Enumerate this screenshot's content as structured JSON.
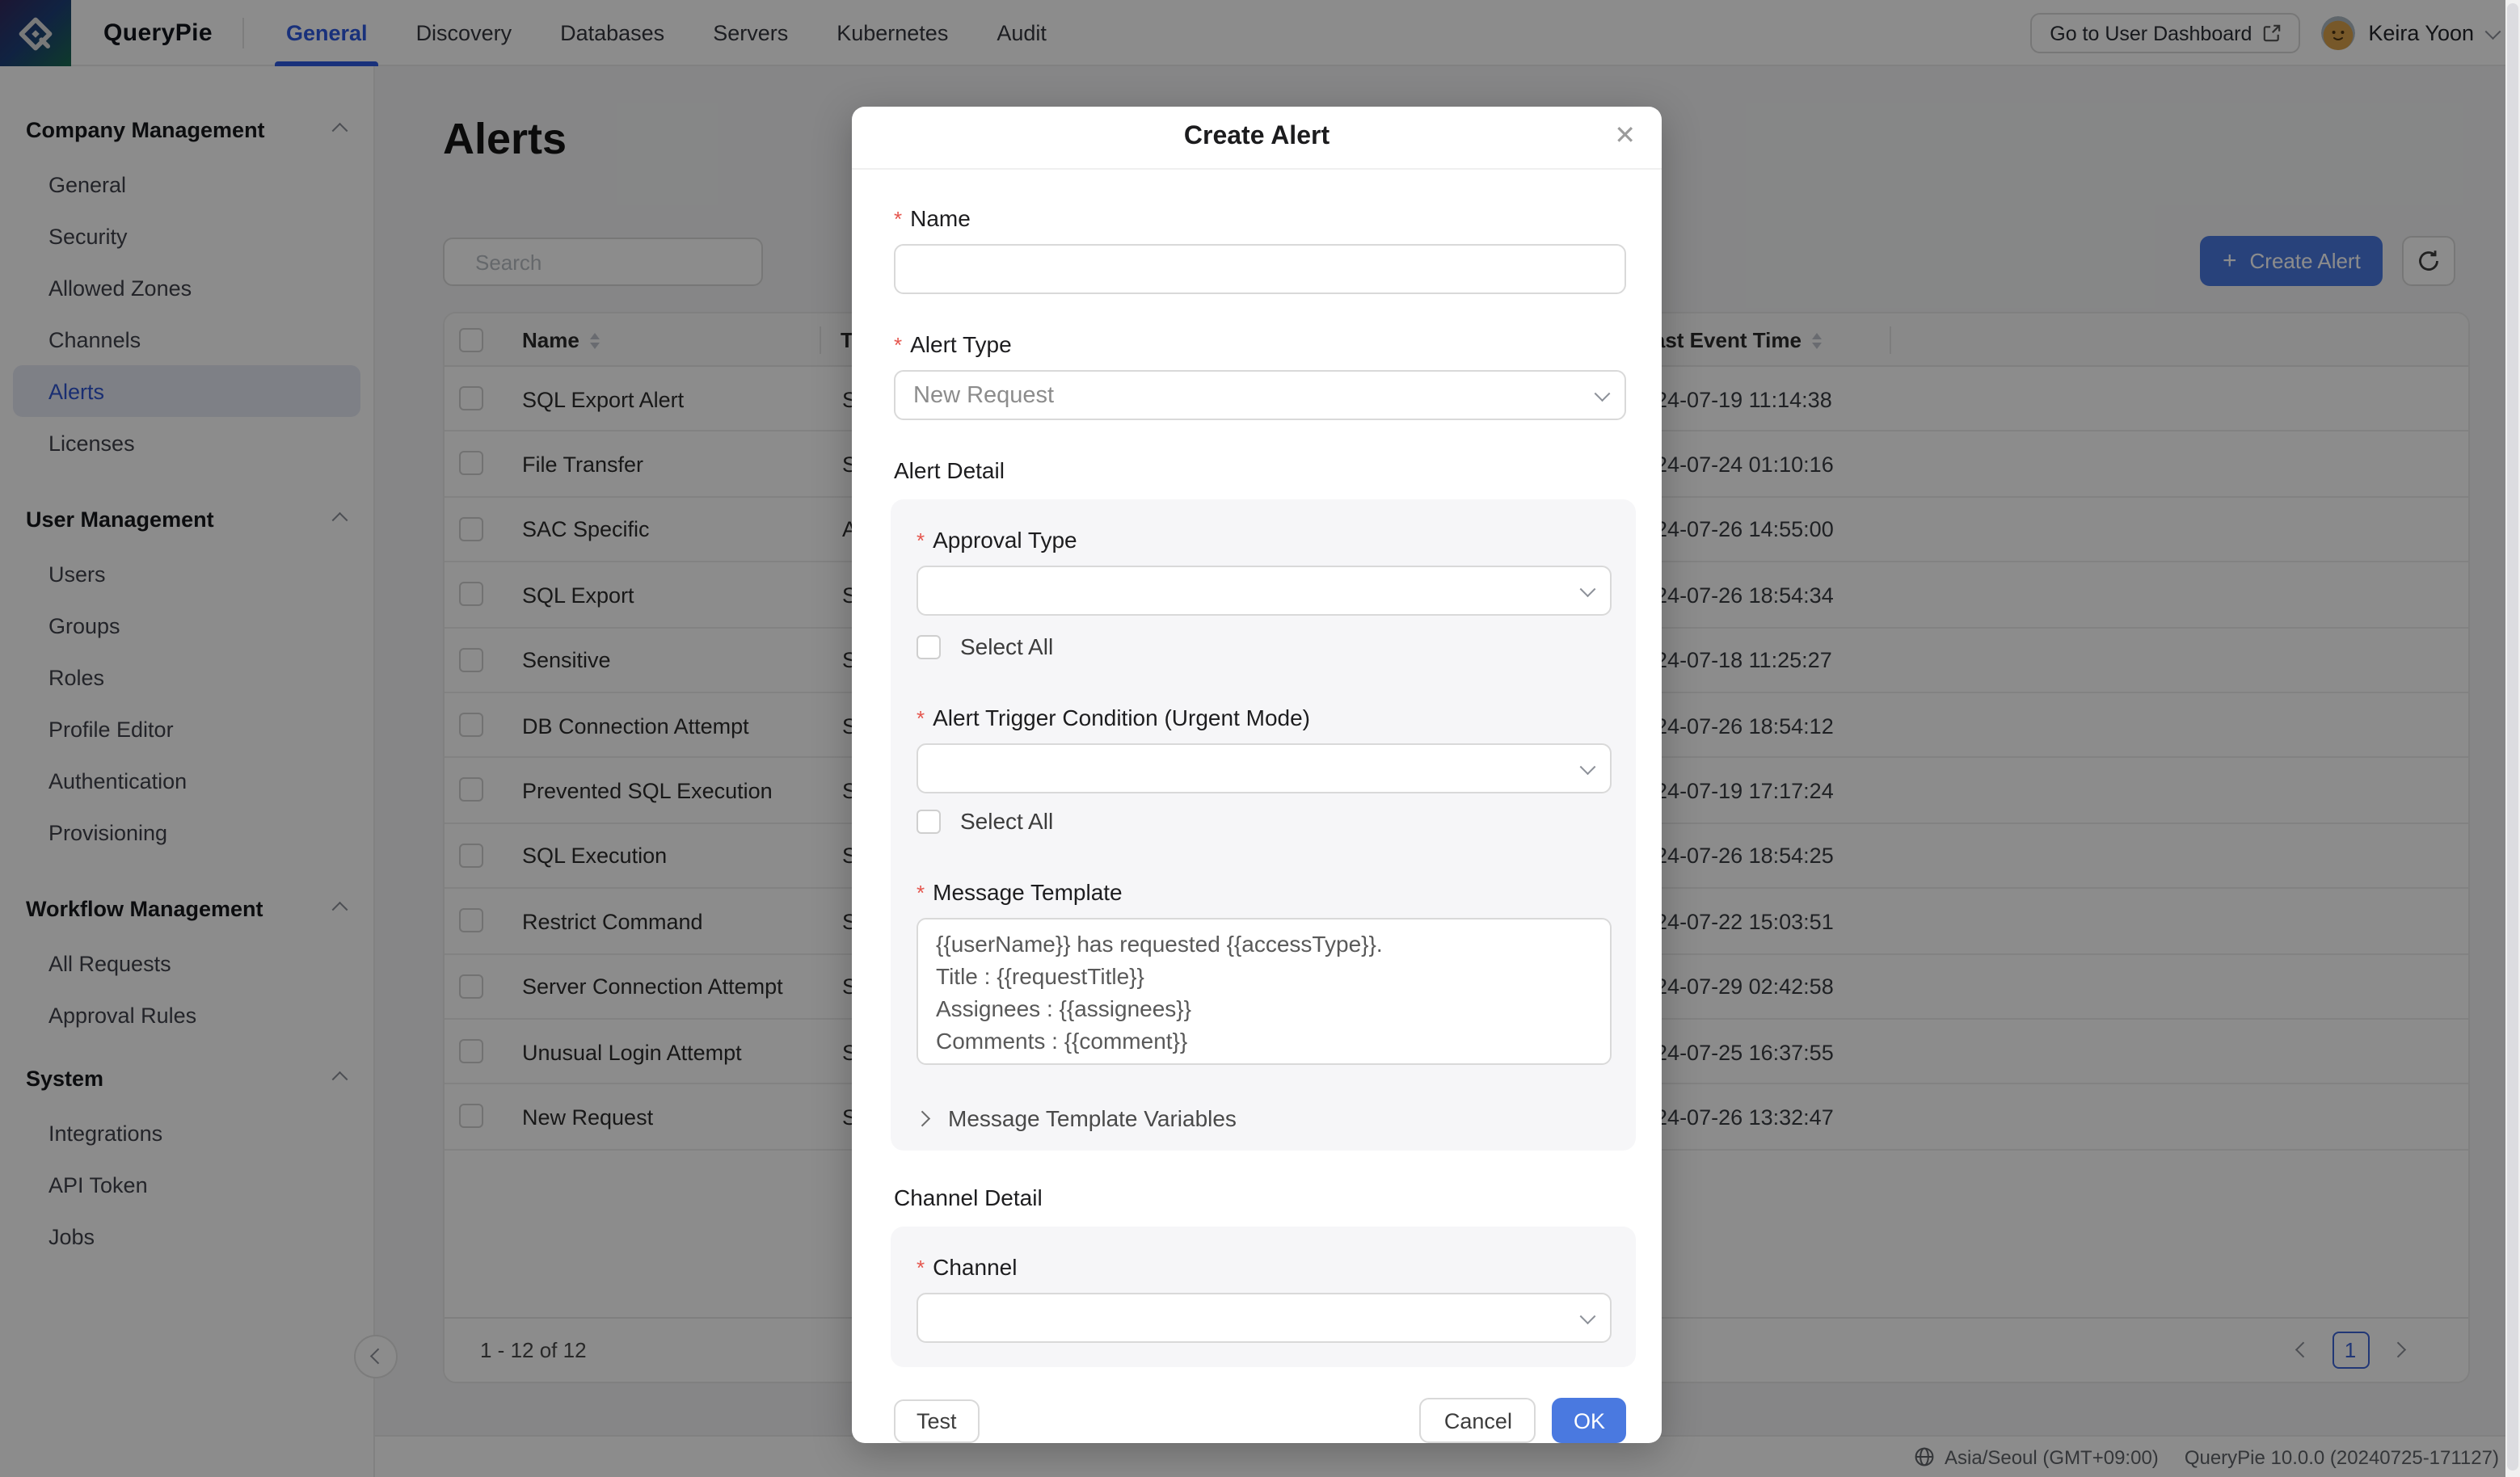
{
  "brand": {
    "name": "QueryPie"
  },
  "topnav": {
    "tabs": [
      {
        "label": "General",
        "active": true
      },
      {
        "label": "Discovery",
        "active": false
      },
      {
        "label": "Databases",
        "active": false
      },
      {
        "label": "Servers",
        "active": false
      },
      {
        "label": "Kubernetes",
        "active": false
      },
      {
        "label": "Audit",
        "active": false
      }
    ],
    "dashboard_button": "Go to User Dashboard",
    "user_name": "Keira Yoon"
  },
  "sidebar": {
    "sections": [
      {
        "title": "Company Management",
        "items": [
          {
            "label": "General",
            "active": false
          },
          {
            "label": "Security",
            "active": false
          },
          {
            "label": "Allowed Zones",
            "active": false
          },
          {
            "label": "Channels",
            "active": false
          },
          {
            "label": "Alerts",
            "active": true
          },
          {
            "label": "Licenses",
            "active": false
          }
        ]
      },
      {
        "title": "User Management",
        "items": [
          {
            "label": "Users",
            "active": false
          },
          {
            "label": "Groups",
            "active": false
          },
          {
            "label": "Roles",
            "active": false
          },
          {
            "label": "Profile Editor",
            "active": false
          },
          {
            "label": "Authentication",
            "active": false
          },
          {
            "label": "Provisioning",
            "active": false
          }
        ]
      },
      {
        "title": "Workflow Management",
        "items": [
          {
            "label": "All Requests",
            "active": false
          },
          {
            "label": "Approval Rules",
            "active": false
          }
        ]
      },
      {
        "title": "System",
        "items": [
          {
            "label": "Integrations",
            "active": false
          },
          {
            "label": "API Token",
            "active": false
          },
          {
            "label": "Jobs",
            "active": false
          }
        ]
      }
    ]
  },
  "page": {
    "title": "Alerts",
    "search_placeholder": "Search",
    "create_button": "Create Alert"
  },
  "table": {
    "columns": {
      "name": "Name",
      "type": "Type",
      "last_event": "Last Event Time"
    },
    "rows": [
      {
        "name": "SQL Export Alert",
        "type_fragment": "S",
        "time": "2024-07-19 11:14:38"
      },
      {
        "name": "File Transfer",
        "type_fragment": "S",
        "time": "2024-07-24 01:10:16"
      },
      {
        "name": "SAC Specific",
        "type_fragment": "A",
        "time": "2024-07-26 14:55:00"
      },
      {
        "name": "SQL Export",
        "type_fragment": "S",
        "time": "2024-07-26 18:54:34"
      },
      {
        "name": "Sensitive",
        "type_fragment": "S",
        "time": "2024-07-18 11:25:27"
      },
      {
        "name": "DB Connection Attempt",
        "type_fragment": "S",
        "time": "2024-07-26 18:54:12"
      },
      {
        "name": "Prevented SQL Execution",
        "type_fragment": "S",
        "time": "2024-07-19 17:17:24"
      },
      {
        "name": "SQL Execution",
        "type_fragment": "S",
        "time": "2024-07-26 18:54:25"
      },
      {
        "name": "Restrict Command",
        "type_fragment": "S",
        "time": "2024-07-22 15:03:51"
      },
      {
        "name": "Server Connection Attempt",
        "type_fragment": "S",
        "time": "2024-07-29 02:42:58"
      },
      {
        "name": "Unusual Login Attempt",
        "type_fragment": "S",
        "time": "2024-07-25 16:37:55"
      },
      {
        "name": "New Request",
        "type_fragment": "S",
        "time": "2024-07-26 13:32:47"
      }
    ],
    "footer": {
      "range": "1 - 12 of 12",
      "page": "1"
    }
  },
  "modal": {
    "title": "Create Alert",
    "name_label": "Name",
    "alert_type_label": "Alert Type",
    "alert_type_value": "New Request",
    "alert_detail_title": "Alert Detail",
    "approval_type_label": "Approval Type",
    "select_all_label": "Select All",
    "trigger_label": "Alert Trigger Condition (Urgent Mode)",
    "select_all_label_2": "Select All",
    "message_template_label": "Message Template",
    "message_template_value": "{{userName}} has requested {{accessType}}.\nTitle : {{requestTitle}}\nAssignees : {{assignees}}\nComments : {{comment}}",
    "variables_toggle": "Message Template Variables",
    "channel_detail_title": "Channel Detail",
    "channel_label": "Channel",
    "test_button": "Test",
    "cancel_button": "Cancel",
    "ok_button": "OK"
  },
  "statusbar": {
    "timezone": "Asia/Seoul (GMT+09:00)",
    "version": "QueryPie 10.0.0 (20240725-171127)"
  },
  "colors": {
    "accent_blue": "#4a79e0",
    "nav_active_blue": "#2e5ae0",
    "sidebar_active_text": "#2f54d0",
    "sidebar_active_bg": "#e5e9f4",
    "required_red": "#e5564e"
  }
}
